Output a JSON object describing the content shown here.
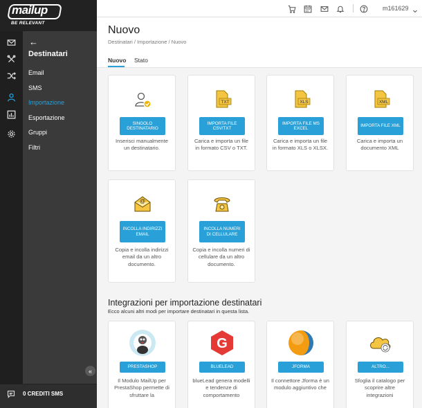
{
  "brand": {
    "logo_text": "mailup",
    "tagline": "BE RELEVANT"
  },
  "topbar": {
    "user": "m161629"
  },
  "nav": {
    "title": "Destinatari",
    "items": [
      "Email",
      "SMS",
      "Importazione",
      "Esportazione",
      "Gruppi",
      "Filtri"
    ],
    "active": "Importazione"
  },
  "sms_credits": "0 CREDITI SMS",
  "header": {
    "title": "Nuovo",
    "breadcrumb": "Destinatari / Importazione / Nuovo",
    "tabs": [
      "Nuovo",
      "Stato"
    ]
  },
  "import_cards": [
    {
      "icon": "user-check-icon",
      "button": "SINGOLO DESTINATARIO",
      "desc": "Inserisci manualmente un destinatario."
    },
    {
      "icon": "txt-file-icon",
      "button": "IMPORTA FILE CSV/TXT",
      "desc": "Carica e importa un file in formato CSV o TXT."
    },
    {
      "icon": "xls-file-icon",
      "button": "IMPORTA FILE MS EXCEL",
      "desc": "Carica e importa un file in formato XLS o XLSX."
    },
    {
      "icon": "xml-file-icon",
      "button": "IMPORTA FILE XML",
      "desc": "Carica e importa un documento XML"
    },
    {
      "icon": "email-envelope-icon",
      "button": "INCOLLA INDIRIZZI EMAIL",
      "desc": "Copia e incolla indirizzi email da un altro documento."
    },
    {
      "icon": "telephone-icon",
      "button": "INCOLLA NUMERI DI CELLULARE",
      "desc": "Copia e incolla numeri di cellulare da un altro documento."
    }
  ],
  "integrations": {
    "title": "Integrazioni per importazione destinatari",
    "subtitle": "Ecco alcuni altri modi per importare destinatari in questa lista.",
    "cards": [
      {
        "icon": "prestashop-logo-icon",
        "button": "PRESTASHOP",
        "desc": "Il Modulo MailUp per PrestaShop permette di sfruttare la"
      },
      {
        "icon": "bluelead-logo-icon",
        "button": "BLUELEAD",
        "desc": "blueLead genera modelli e tendenze di comportamento"
      },
      {
        "icon": "jforma-logo-icon",
        "button": "JFORMA",
        "desc": "Il connettore Jforma è un modulo aggiuntivo che"
      },
      {
        "icon": "cloud-sync-icon",
        "button": "ALTRO...",
        "desc": "Sfoglia il catalogo per scoprire altre integrazioni"
      }
    ]
  },
  "colors": {
    "accent": "#29a1d8",
    "sidebar": "#3a3a3a",
    "rail": "#1f1f1f"
  }
}
